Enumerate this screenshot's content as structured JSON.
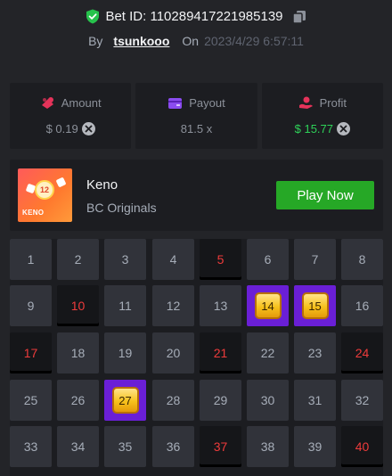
{
  "header": {
    "bet_id_label": "Bet ID: 110289417221985139",
    "by_label": "By",
    "username": "tsunkooo",
    "on_label": "On",
    "date": "2023/4/29 6:57:11",
    "icons": {
      "verified": "shield-check-icon",
      "copy": "copy-icon"
    }
  },
  "stats": {
    "amount": {
      "label": "Amount",
      "value": "$ 0.19",
      "icon": "coins-icon"
    },
    "payout": {
      "label": "Payout",
      "value": "81.5 x",
      "icon": "wallet-icon"
    },
    "profit": {
      "label": "Profit",
      "value": "$ 15.77",
      "icon": "hand-coin-icon"
    }
  },
  "game": {
    "title": "Keno",
    "subtitle": "BC Originals",
    "play_label": "Play Now",
    "thumb_ball": "12",
    "thumb_label": "KENO"
  },
  "board": {
    "cells": [
      {
        "n": "1",
        "s": "none"
      },
      {
        "n": "2",
        "s": "none"
      },
      {
        "n": "3",
        "s": "none"
      },
      {
        "n": "4",
        "s": "none"
      },
      {
        "n": "5",
        "s": "drawn"
      },
      {
        "n": "6",
        "s": "none"
      },
      {
        "n": "7",
        "s": "none"
      },
      {
        "n": "8",
        "s": "none"
      },
      {
        "n": "9",
        "s": "none"
      },
      {
        "n": "10",
        "s": "drawn"
      },
      {
        "n": "11",
        "s": "none"
      },
      {
        "n": "12",
        "s": "none"
      },
      {
        "n": "13",
        "s": "none"
      },
      {
        "n": "14",
        "s": "hit"
      },
      {
        "n": "15",
        "s": "hit"
      },
      {
        "n": "16",
        "s": "none"
      },
      {
        "n": "17",
        "s": "drawn"
      },
      {
        "n": "18",
        "s": "none"
      },
      {
        "n": "19",
        "s": "none"
      },
      {
        "n": "20",
        "s": "none"
      },
      {
        "n": "21",
        "s": "drawn"
      },
      {
        "n": "22",
        "s": "none"
      },
      {
        "n": "23",
        "s": "none"
      },
      {
        "n": "24",
        "s": "drawn"
      },
      {
        "n": "25",
        "s": "none"
      },
      {
        "n": "26",
        "s": "none"
      },
      {
        "n": "27",
        "s": "hit"
      },
      {
        "n": "28",
        "s": "none"
      },
      {
        "n": "29",
        "s": "none"
      },
      {
        "n": "30",
        "s": "none"
      },
      {
        "n": "31",
        "s": "none"
      },
      {
        "n": "32",
        "s": "none"
      },
      {
        "n": "33",
        "s": "none"
      },
      {
        "n": "34",
        "s": "none"
      },
      {
        "n": "35",
        "s": "none"
      },
      {
        "n": "36",
        "s": "none"
      },
      {
        "n": "37",
        "s": "drawn"
      },
      {
        "n": "38",
        "s": "none"
      },
      {
        "n": "39",
        "s": "none"
      },
      {
        "n": "40",
        "s": "drawn"
      }
    ]
  },
  "colors": {
    "background": "#232428",
    "panel": "#1c1d21",
    "cell": "#31333a",
    "drawn_text": "#ee3b3b",
    "hit_bg": "#6a1fd6",
    "gem": "#f7c21c",
    "profit_green": "#2ed158",
    "play_button": "#26a826"
  }
}
